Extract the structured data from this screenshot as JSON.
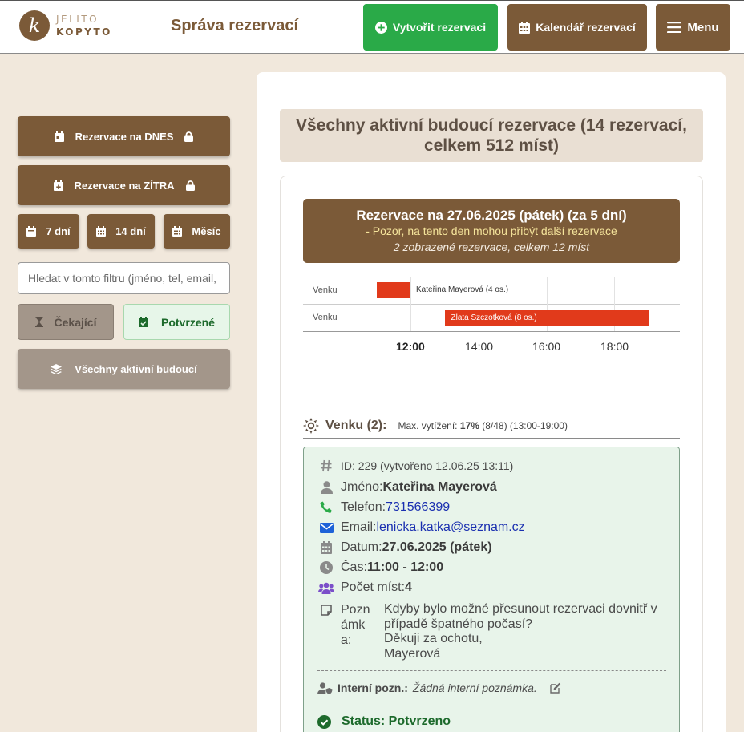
{
  "header": {
    "logo_line1": "JELITO",
    "logo_line2": "KOPYTO",
    "logo_mark": "k",
    "title": "Správa rezervací",
    "create_label": "Vytvořit rezervaci",
    "calendar_label": "Kalendář rezervací",
    "menu_label": "Menu"
  },
  "sidebar": {
    "today_label": "Rezervace na DNES",
    "tomorrow_label": "Rezervace na ZÍTRA",
    "days7_label": "7 dní",
    "days14_label": "14 dní",
    "month_label": "Měsíc",
    "search_placeholder": "Hledat v tomto filtru (jméno, tel, email, ...)",
    "pending_label": "Čekající",
    "confirmed_label": "Potvrzené",
    "all_label": "Všechny aktivní budoucí"
  },
  "main": {
    "title": "Všechny aktivní budoucí rezervace (14 rezervací, celkem 512 míst)",
    "day": {
      "heading": "Rezervace na 27.06.2025 (pátek) (za 5 dní)",
      "warning": "- Pozor, na tento den mohou přibýt další rezervace",
      "summary": "2 zobrazené rezervace, celkem 12 míst"
    },
    "timeline": {
      "rows": [
        {
          "area": "Venku",
          "label": "Kateřina Mayerová (4 os.)",
          "start": 11.0,
          "end": 12.0
        },
        {
          "area": "Venku",
          "label": "Zlata Szczotková (8 os.)",
          "start": 13.0,
          "end": 19.0
        }
      ],
      "ticks": [
        "12:00",
        "14:00",
        "16:00",
        "18:00"
      ]
    },
    "section": {
      "name": "Venku (2):",
      "occupancy_label": "Max. vytížení:",
      "occupancy_pct": "17%",
      "occupancy_rest": "(8/48) (13:00-19:00)"
    },
    "reservation": {
      "id_line": "ID: 229 (vytvořeno 12.06.25 13:11)",
      "name_label": "Jméno:",
      "name": "Kateřina Mayerová",
      "phone_label": "Telefon:",
      "phone": "731566399",
      "email_label": "Email:",
      "email": "lenicka.katka@seznam.cz",
      "date_label": "Datum:",
      "date": "27.06.2025 (pátek)",
      "time_label": "Čas:",
      "time": "11:00 - 12:00",
      "seats_label": "Počet míst:",
      "seats": "4",
      "note_label": "Poznámka:",
      "note_line1": "Kdyby bylo možné přesunout rezervaci dovnitř v případě špatného počasí?",
      "note_line2": "Děkuji za ochotu,",
      "note_line3": "Mayerová",
      "internal_label": "Interní pozn.:",
      "internal_text": "Žádná interní poznámka.",
      "status": "Status: Potvrzeno"
    }
  },
  "colors": {
    "brown": "#7b5a38",
    "green": "#2aaa48",
    "bar_red": "#e13a1b"
  }
}
